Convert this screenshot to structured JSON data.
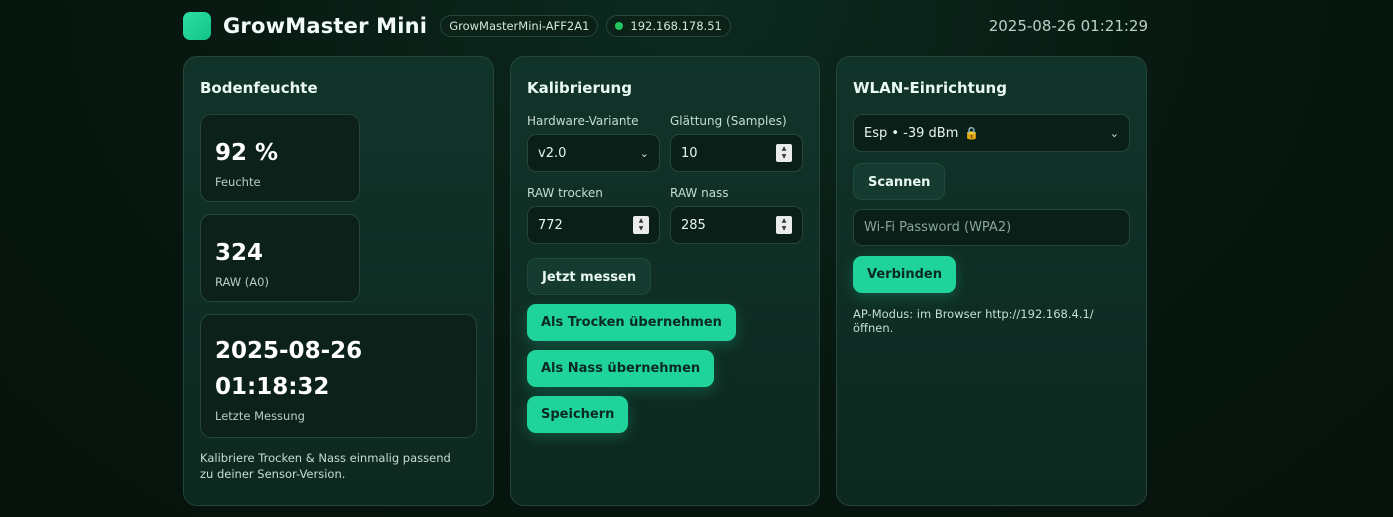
{
  "header": {
    "title": "GrowMaster Mini",
    "hostname": "GrowMasterMini-AFF2A1",
    "ip": "192.168.178.51",
    "datetime": "2025-08-26 01:21:29",
    "status_color": "#22c55e"
  },
  "boden": {
    "title": "Bodenfeuchte",
    "moisture_value": "92 %",
    "moisture_label": "Feuchte",
    "raw_value": "324",
    "raw_label": "RAW (A0)",
    "last_date": "2025-08-26",
    "last_time": "01:18:32",
    "last_label": "Letzte Messung",
    "note": "Kalibriere Trocken & Nass einmalig passend zu deiner Sensor-Version."
  },
  "kalib": {
    "title": "Kalibrierung",
    "hw_label": "Hardware-Variante",
    "hw_value": "v2.0",
    "smooth_label": "Glättung (Samples)",
    "smooth_value": "10",
    "dry_label": "RAW trocken",
    "dry_value": "772",
    "wet_label": "RAW nass",
    "wet_value": "285",
    "measure_button": "Jetzt messen",
    "set_dry_button": "Als Trocken übernehmen",
    "set_wet_button": "Als Nass übernehmen",
    "save_button": "Speichern"
  },
  "wlan": {
    "title": "WLAN-Einrichtung",
    "network": "Esp • -39 dBm",
    "scan_button": "Scannen",
    "password_placeholder": "Wi-Fi Password (WPA2)",
    "connect_button": "Verbinden",
    "ap_note": "AP-Modus: im Browser http://192.168.4.1/ öffnen."
  },
  "colors": {
    "accent": "#1fd39a",
    "background": "#07170f"
  }
}
